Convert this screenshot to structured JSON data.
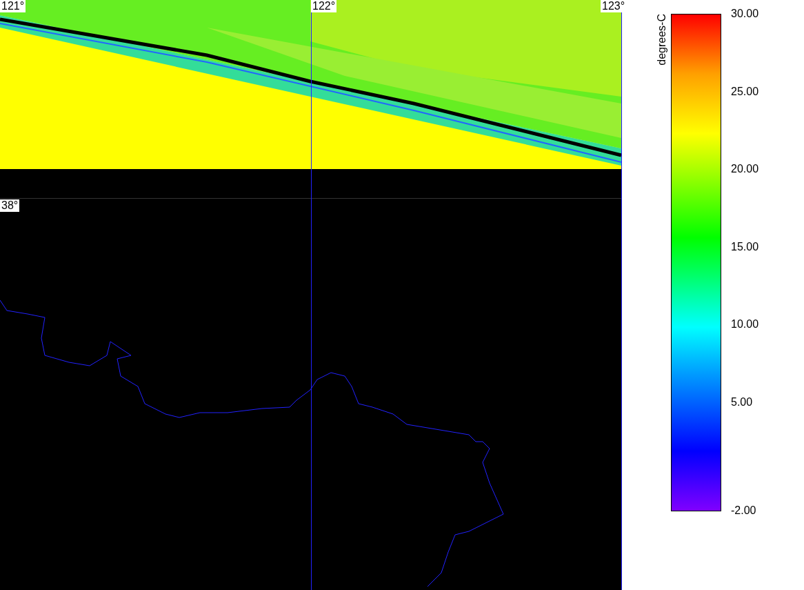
{
  "map": {
    "longitude_labels": [
      "121°",
      "122°",
      "123°"
    ],
    "latitude_labels": [
      "38°"
    ]
  },
  "colorbar": {
    "unit": "degrees-C",
    "ticks": [
      "30.00",
      "25.00",
      "20.00",
      "15.00",
      "10.00",
      "5.00",
      "-2.00"
    ]
  }
}
